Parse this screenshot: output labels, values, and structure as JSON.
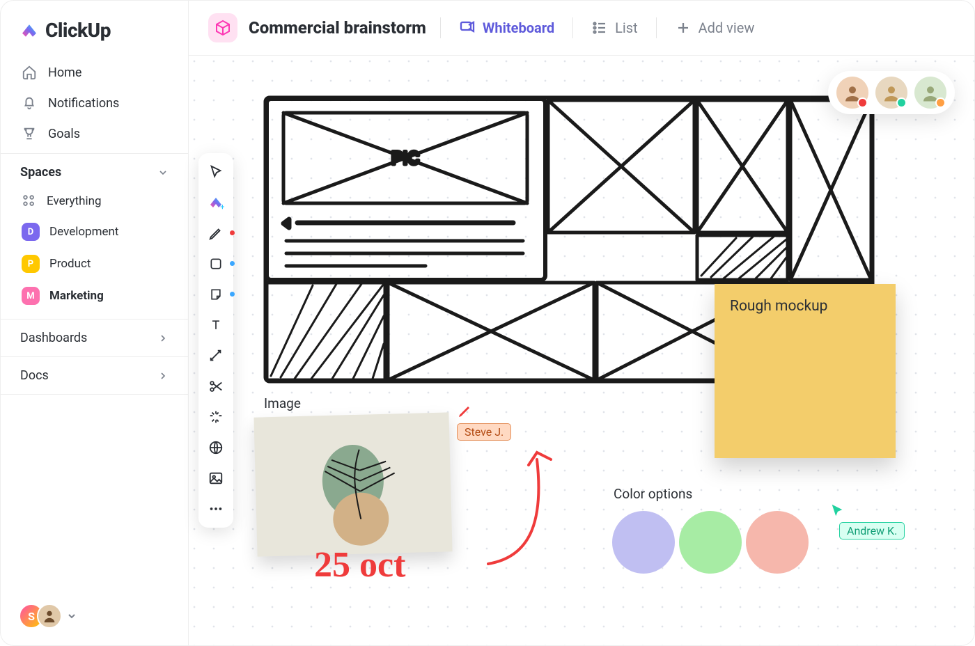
{
  "brand": "ClickUp",
  "nav": {
    "home": "Home",
    "notifications": "Notifications",
    "goals": "Goals"
  },
  "spaces": {
    "header": "Spaces",
    "everything": "Everything",
    "items": [
      {
        "key": "D",
        "label": "Development",
        "color": "#7b68ee"
      },
      {
        "key": "P",
        "label": "Product",
        "color": "#ffc800"
      },
      {
        "key": "M",
        "label": "Marketing",
        "color": "#fd71af"
      }
    ]
  },
  "sections": {
    "dashboards": "Dashboards",
    "docs": "Docs"
  },
  "user": {
    "initial": "S"
  },
  "header": {
    "title": "Commercial brainstorm",
    "views": {
      "whiteboard": "Whiteboard",
      "list": "List",
      "add": "Add view"
    }
  },
  "tools": [
    "cursor",
    "clickup-add",
    "pen",
    "shape-square",
    "sticky-note",
    "text",
    "connector",
    "scissors",
    "sparkle",
    "globe",
    "image",
    "more"
  ],
  "presence_status": [
    "#ef3b3b",
    "#21d19f",
    "#ff9f43"
  ],
  "canvas": {
    "sketch_label": "PIC",
    "sticky": "Rough mockup",
    "image_label": "Image",
    "color_label": "Color options",
    "swatches": [
      "#c0bff2",
      "#a7eca4",
      "#f6b7ac"
    ],
    "handwriting": "25 oct",
    "cursor1": "Steve J.",
    "cursor2": "Andrew K."
  }
}
